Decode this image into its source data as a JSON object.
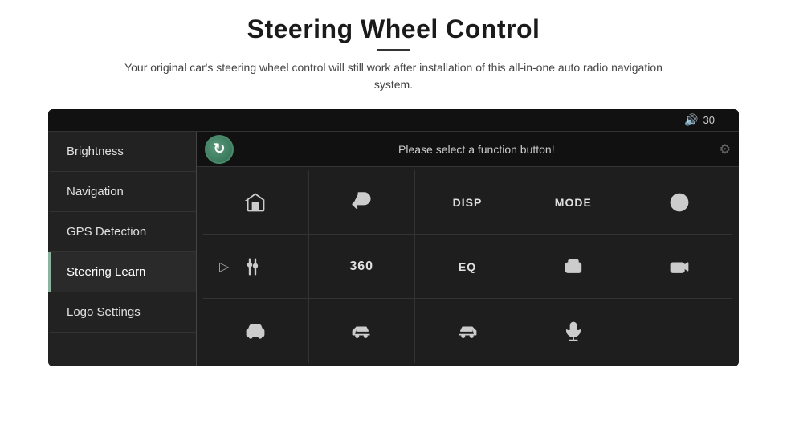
{
  "header": {
    "title": "Steering Wheel Control",
    "divider": true,
    "subtitle": "Your original car's steering wheel control will still work after installation of this all-in-one auto radio navigation system."
  },
  "car_ui": {
    "volume": {
      "icon": "🔊",
      "level": "30"
    },
    "menu_items": [
      {
        "id": "brightness",
        "label": "Brightness",
        "active": false
      },
      {
        "id": "navigation",
        "label": "Navigation",
        "active": false
      },
      {
        "id": "gps",
        "label": "GPS Detection",
        "active": false
      },
      {
        "id": "steering",
        "label": "Steering Learn",
        "active": true
      },
      {
        "id": "logo",
        "label": "Logo Settings",
        "active": false
      }
    ],
    "function_bar": {
      "button_label": "↻",
      "prompt": "Please select a function button!"
    },
    "grid": {
      "rows": [
        [
          {
            "type": "icon",
            "symbol": "home",
            "label": "home-icon"
          },
          {
            "type": "icon",
            "symbol": "back",
            "label": "back-icon"
          },
          {
            "type": "text",
            "text": "DISP",
            "label": "disp-button"
          },
          {
            "type": "text",
            "text": "MODE",
            "label": "mode-button"
          },
          {
            "type": "icon",
            "symbol": "phone-slash",
            "label": "phone-slash-icon"
          }
        ],
        [
          {
            "type": "icon",
            "symbol": "tune",
            "label": "tune-icon",
            "has_cursor": true
          },
          {
            "type": "text",
            "text": "360",
            "label": "360-button"
          },
          {
            "type": "text",
            "text": "EQ",
            "label": "eq-button"
          },
          {
            "type": "icon",
            "symbol": "camera1",
            "label": "camera1-icon"
          },
          {
            "type": "icon",
            "symbol": "camera2",
            "label": "camera2-icon"
          }
        ],
        [
          {
            "type": "icon",
            "symbol": "car-front",
            "label": "car-front-icon"
          },
          {
            "type": "icon",
            "symbol": "car-left",
            "label": "car-left-icon"
          },
          {
            "type": "icon",
            "symbol": "car-right",
            "label": "car-right-icon"
          },
          {
            "type": "icon",
            "symbol": "microphone",
            "label": "microphone-icon"
          },
          {
            "type": "empty",
            "label": "empty-cell"
          }
        ]
      ]
    }
  }
}
